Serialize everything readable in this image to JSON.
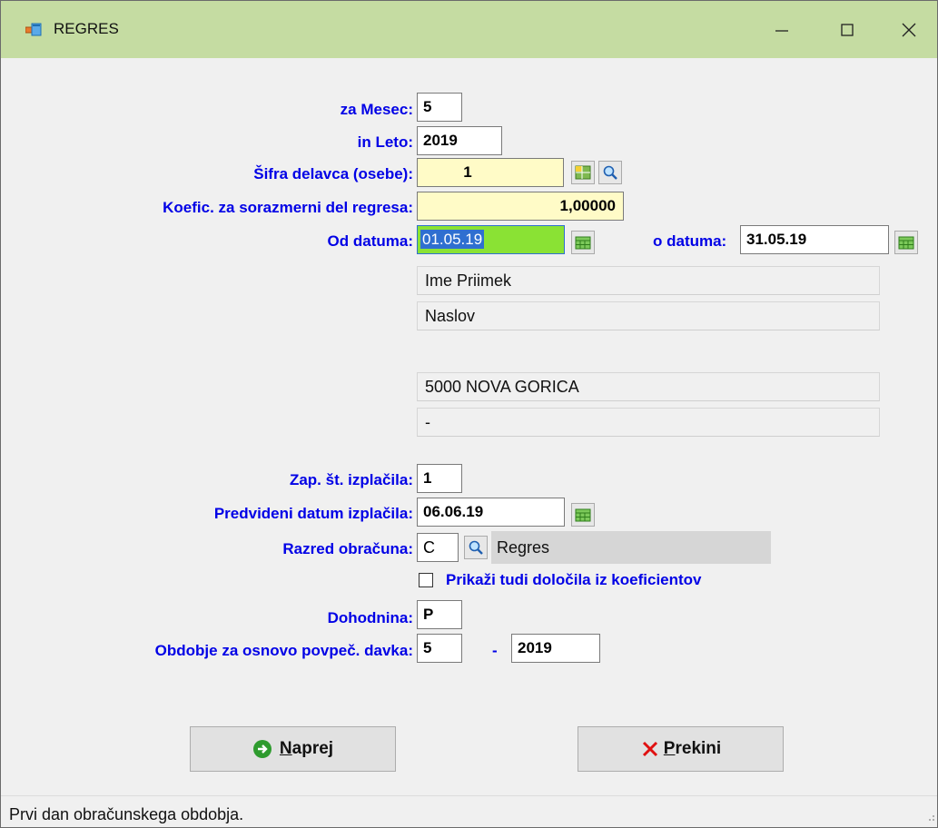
{
  "window": {
    "title": "REGRES"
  },
  "form": {
    "mesec": {
      "label": "za Mesec:",
      "value": "5"
    },
    "leto": {
      "label": "in Leto:",
      "value": "2019"
    },
    "sifra": {
      "label": "Šifra delavca (osebe):",
      "value": "1"
    },
    "koef": {
      "label": "Koefic. za sorazmerni del regresa:",
      "value": "1,00000"
    },
    "od_datuma": {
      "label": "Od datuma:",
      "value": "01.05.19"
    },
    "do_datuma": {
      "label": "o datuma:",
      "value": "31.05.19"
    },
    "person": {
      "name": "Ime Priimek",
      "address": "Naslov",
      "line3": "",
      "post": "5000 NOVA GORICA",
      "extra": "-"
    },
    "zap_st": {
      "label": "Zap. št. izplačila:",
      "value": "1"
    },
    "predvideni": {
      "label": "Predvideni datum izplačila:",
      "value": "06.06.19"
    },
    "razred": {
      "label": "Razred obračuna:",
      "value": "C",
      "desc": "Regres"
    },
    "prikazi": {
      "label": "Prikaži tudi določila iz koeficientov",
      "checked": false
    },
    "dohodnina": {
      "label": "Dohodnina:",
      "value": "P"
    },
    "obdobje": {
      "label": "Obdobje za osnovo povpeč. davka:",
      "month": "5",
      "sep": "-",
      "year": "2019"
    }
  },
  "buttons": {
    "naprej_mnemonic": "N",
    "naprej_rest": "aprej",
    "prekini_mnemonic": "P",
    "prekini_rest": "rekini"
  },
  "status": {
    "text": "Prvi dan obračunskega obdobja."
  },
  "colors": {
    "titlebar": "#c5dca2",
    "label": "#0000e6",
    "highlight_input": "#fffbc7",
    "focused_input": "#8ae234",
    "selection": "#2f6fd0"
  }
}
